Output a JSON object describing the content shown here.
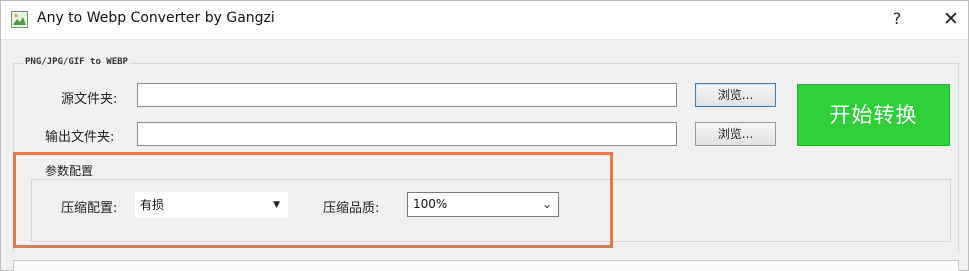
{
  "window": {
    "title": "Any to Webp Converter by Gangzi",
    "help_label": "?",
    "close_label": "✕",
    "app_icon": "app-image-icon"
  },
  "group": {
    "label": "PNG/JPG/GIF to WEBP"
  },
  "source": {
    "label": "源文件夹:",
    "value": "",
    "browse_label": "浏览..."
  },
  "output": {
    "label": "输出文件夹:",
    "value": "",
    "browse_label": "浏览..."
  },
  "start_button": {
    "label": "开始转换",
    "color": "#2fcf3a"
  },
  "params": {
    "title": "参数配置",
    "compression_mode_label": "压缩配置:",
    "compression_mode_value": "有损",
    "quality_label": "压缩品质:",
    "quality_value": "100%"
  },
  "colors": {
    "highlight_border": "#e07a4a"
  }
}
